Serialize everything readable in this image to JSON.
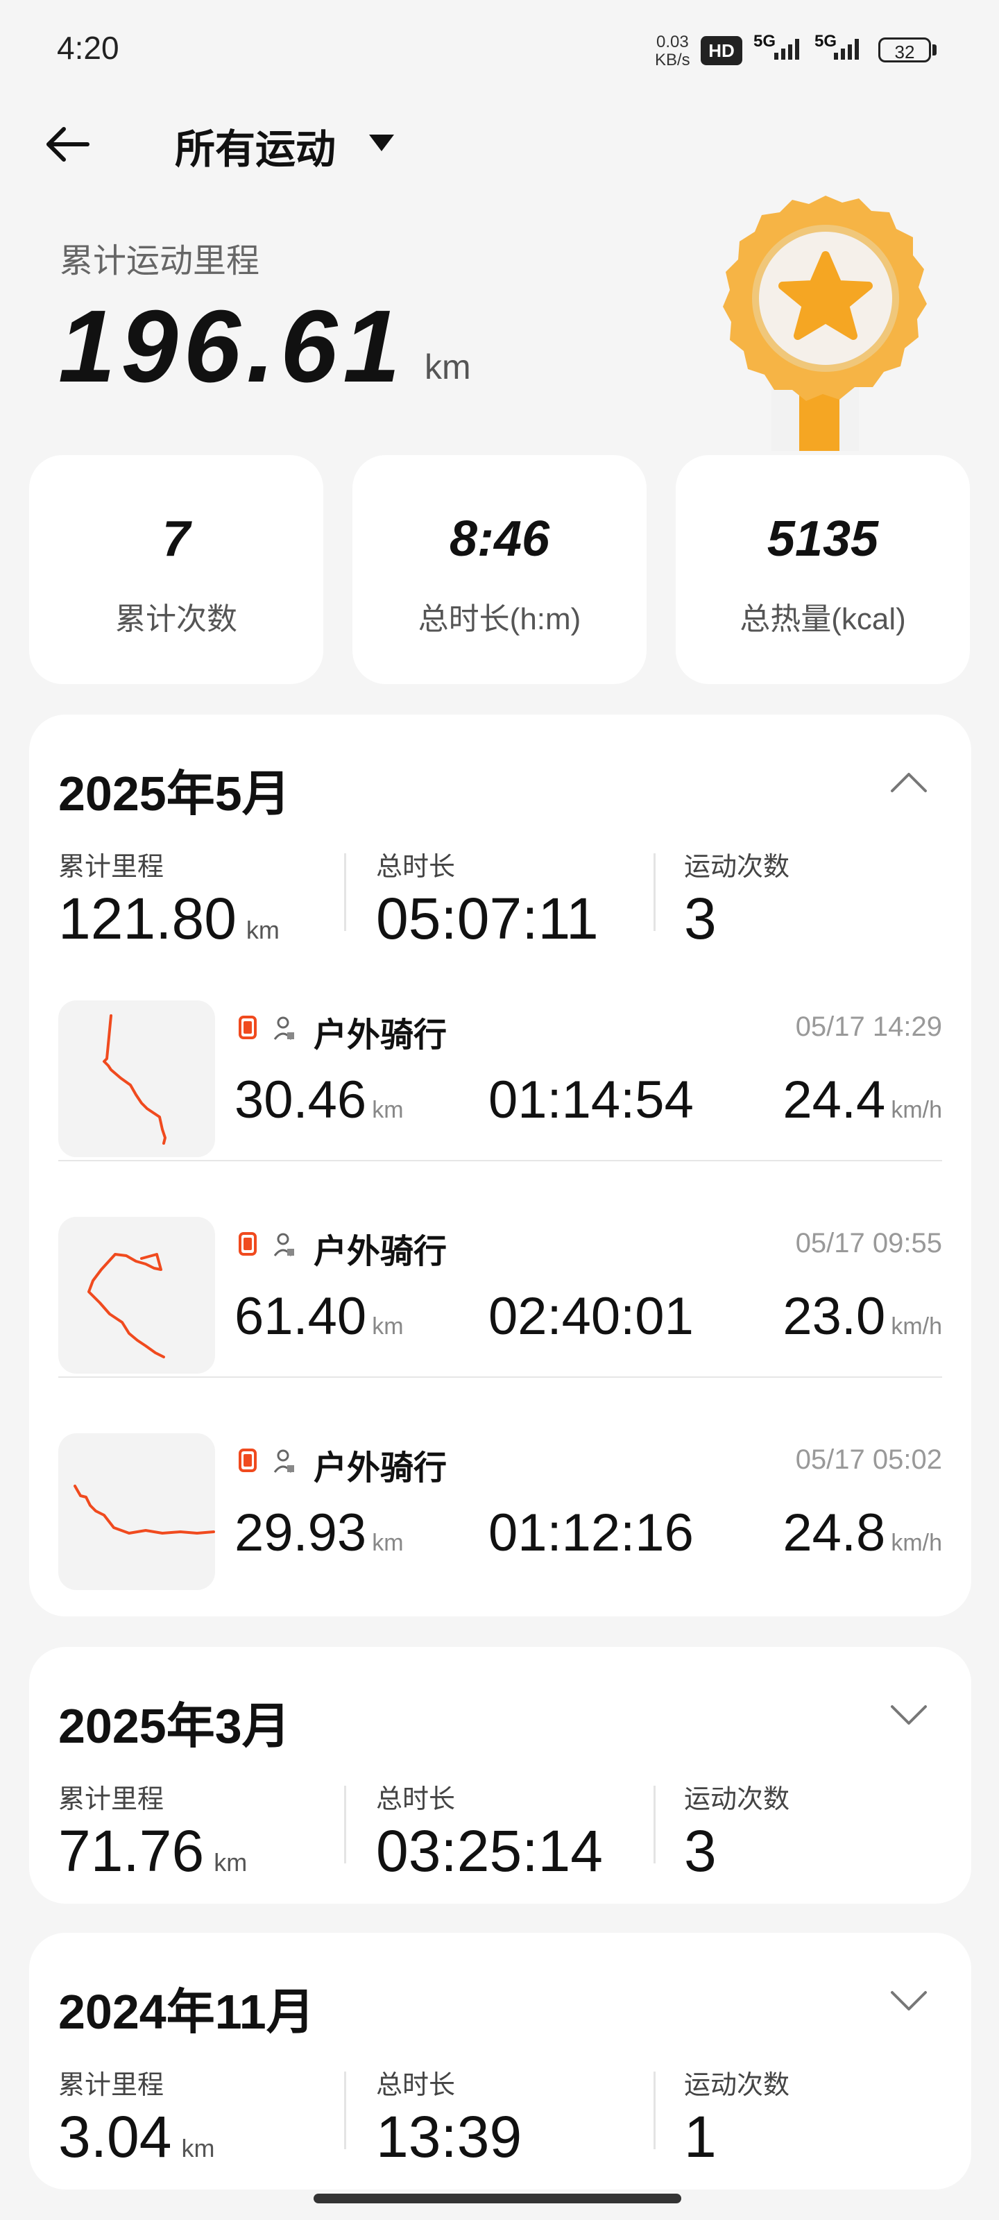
{
  "status_bar": {
    "time": "4:20",
    "net_speed_value": "0.03",
    "net_speed_unit": "KB/s",
    "hd_badge": "HD",
    "signal1_label": "5G",
    "signal2_label": "5G",
    "battery": "32"
  },
  "header": {
    "title": "所有运动"
  },
  "summary": {
    "distance_label": "累计运动里程",
    "distance_value": "196.61",
    "distance_unit": "km",
    "stats": [
      {
        "value": "7",
        "label": "累计次数"
      },
      {
        "value": "8:46",
        "label": "总时长(h:m)"
      },
      {
        "value": "5135",
        "label": "总热量(kcal)"
      }
    ]
  },
  "months": [
    {
      "title": "2025年5月",
      "expanded": true,
      "distance_label": "累计里程",
      "distance_value": "121.80",
      "distance_unit": "km",
      "duration_label": "总时长",
      "duration_value": "05:07:11",
      "count_label": "运动次数",
      "count_value": "3",
      "activities": [
        {
          "name": "户外骑行",
          "datetime": "05/17 14:29",
          "distance": "30.46",
          "distance_unit": "km",
          "duration": "01:14:54",
          "speed": "24.4",
          "speed_unit": "km/h"
        },
        {
          "name": "户外骑行",
          "datetime": "05/17 09:55",
          "distance": "61.40",
          "distance_unit": "km",
          "duration": "02:40:01",
          "speed": "23.0",
          "speed_unit": "km/h"
        },
        {
          "name": "户外骑行",
          "datetime": "05/17 05:02",
          "distance": "29.93",
          "distance_unit": "km",
          "duration": "01:12:16",
          "speed": "24.8",
          "speed_unit": "km/h"
        }
      ]
    },
    {
      "title": "2025年3月",
      "expanded": false,
      "distance_label": "累计里程",
      "distance_value": "71.76",
      "distance_unit": "km",
      "duration_label": "总时长",
      "duration_value": "03:25:14",
      "count_label": "运动次数",
      "count_value": "3"
    },
    {
      "title": "2024年11月",
      "expanded": false,
      "distance_label": "累计里程",
      "distance_value": "3.04",
      "distance_unit": "km",
      "duration_label": "总时长",
      "duration_value": "13:39",
      "count_label": "运动次数",
      "count_value": "1"
    }
  ],
  "colors": {
    "accent": "#f04a1e",
    "medal_gold": "#f5b642",
    "background": "#f5f5f5",
    "card": "#ffffff"
  },
  "icons": {
    "back": "arrow-left-icon",
    "title_dropdown": "caret-down-icon",
    "collapse": "chevron-up-icon",
    "expand": "chevron-down-icon",
    "device": "watch-icon",
    "person": "person-icon",
    "medal": "medal-icon"
  }
}
